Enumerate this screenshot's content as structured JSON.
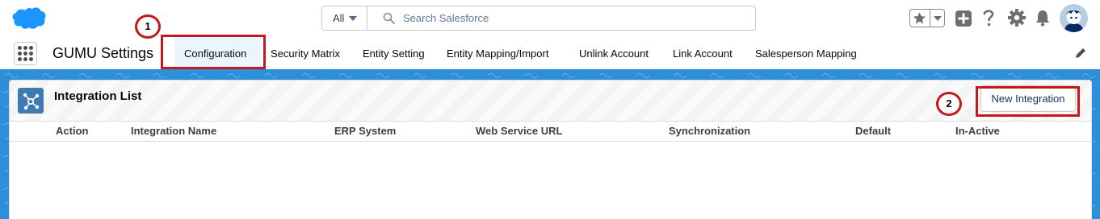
{
  "header": {
    "search": {
      "scope": "All",
      "placeholder": "Search Salesforce"
    }
  },
  "nav": {
    "app_name": "GUMU Settings",
    "tabs": [
      {
        "label": "Configuration",
        "active": true
      },
      {
        "label": "Security Matrix",
        "active": false
      },
      {
        "label": "Entity Setting",
        "active": false
      },
      {
        "label": "Entity Mapping/Import",
        "active": false
      },
      {
        "label": "Unlink Account",
        "active": false
      },
      {
        "label": "Link Account",
        "active": false
      },
      {
        "label": "Salesperson Mapping",
        "active": false
      }
    ]
  },
  "annotations": {
    "marker_1": "1",
    "marker_2": "2"
  },
  "card": {
    "title": "Integration List",
    "new_button_label": "New Integration",
    "columns": [
      "Action",
      "Integration Name",
      "ERP System",
      "Web Service URL",
      "Synchronization",
      "Default",
      "In-Active"
    ],
    "rows": []
  },
  "colors": {
    "brand_blue": "#1b96ff",
    "background_blue": "#2d8fd8",
    "annotation_red": "#c8161d",
    "active_tab_bg": "#eaf5fe"
  }
}
